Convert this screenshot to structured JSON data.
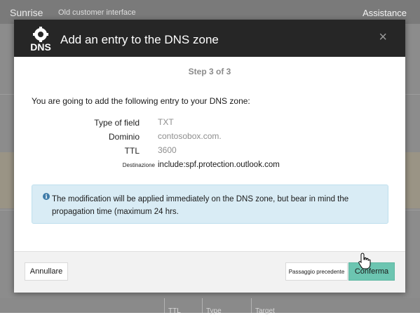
{
  "app": {
    "brand": "Sunrise",
    "subtitle": "Old customer interface",
    "assistance": "Assistance"
  },
  "modal": {
    "title": "Add an entry to the DNS zone",
    "logo_text": "DNS",
    "close_label": "×",
    "step": "Step 3 of 3",
    "intro": "You are going to add the following entry to your DNS zone:",
    "fields": [
      {
        "label": "Type of field",
        "value": "TXT"
      },
      {
        "label": "Dominio",
        "value": "contosobox.com."
      },
      {
        "label": "TTL",
        "value": "3600"
      },
      {
        "label": "Destinazione",
        "value": "include:spf.protection.outlook.com"
      }
    ],
    "info": "The modification will be applied immediately on the DNS zone, but bear in mind the propagation time (maximum 24 hrs.",
    "buttons": {
      "cancel": "Annullare",
      "previous": "Passaggio precedente",
      "confirm": "Conferma"
    }
  },
  "background": {
    "table_headers": [
      "TTL",
      "Type",
      "Target"
    ]
  },
  "colors": {
    "header_bg": "#262626",
    "confirm_button": "#6cc5b1",
    "info_bg": "#d9ecf5",
    "topbar_bg": "#7a7a7a"
  },
  "icons": {
    "logo": "dns-gear-icon",
    "close": "close-icon",
    "info": "info-icon",
    "cursor": "hand-pointer-icon"
  }
}
